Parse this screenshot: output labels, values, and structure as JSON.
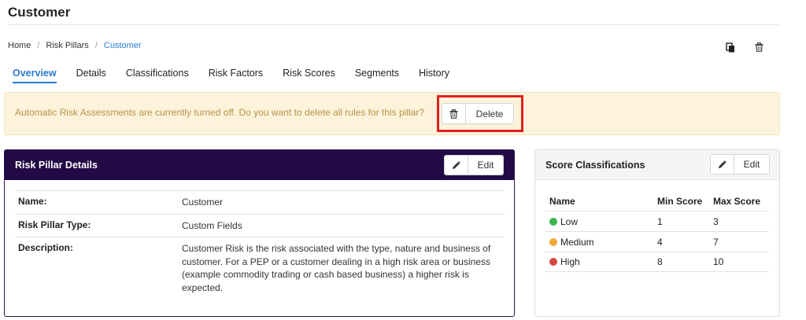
{
  "page": {
    "title": "Customer"
  },
  "breadcrumb": {
    "items": [
      "Home",
      "Risk Pillars",
      "Customer"
    ],
    "separator": "/"
  },
  "header_actions": {
    "icons": [
      "copy-icon",
      "trash-icon"
    ]
  },
  "tabs": [
    {
      "label": "Overview",
      "active": true
    },
    {
      "label": "Details"
    },
    {
      "label": "Classifications"
    },
    {
      "label": "Risk Factors"
    },
    {
      "label": "Risk Scores"
    },
    {
      "label": "Segments"
    },
    {
      "label": "History"
    }
  ],
  "alert": {
    "text": "Automatic Risk Assessments are currently turned off. Do you want to delete all rules for this pillar?",
    "button_label": "Delete"
  },
  "risk_pillar_details": {
    "title": "Risk Pillar Details",
    "edit_label": "Edit",
    "rows": [
      {
        "label": "Name:",
        "value": "Customer"
      },
      {
        "label": "Risk Pillar Type:",
        "value": "Custom Fields"
      },
      {
        "label": "Description:",
        "value": "Customer Risk is the risk associated with the type, nature and business of customer. For a PEP or a customer dealing in a high risk area or business (example commodity trading or cash based business) a higher risk is expected."
      }
    ]
  },
  "score_classifications": {
    "title": "Score Classifications",
    "edit_label": "Edit",
    "columns": [
      "Name",
      "Min Score",
      "Max Score"
    ],
    "rows": [
      {
        "name": "Low",
        "min": "1",
        "max": "3",
        "color": "#3cb44b"
      },
      {
        "name": "Medium",
        "min": "4",
        "max": "7",
        "color": "#f0a93b"
      },
      {
        "name": "High",
        "min": "8",
        "max": "10",
        "color": "#d9453d"
      }
    ]
  },
  "colors": {
    "accent": "#2a7bd3",
    "header_dark": "#210a45",
    "alert_bg": "#fcf3da",
    "highlight": "#e02020"
  }
}
